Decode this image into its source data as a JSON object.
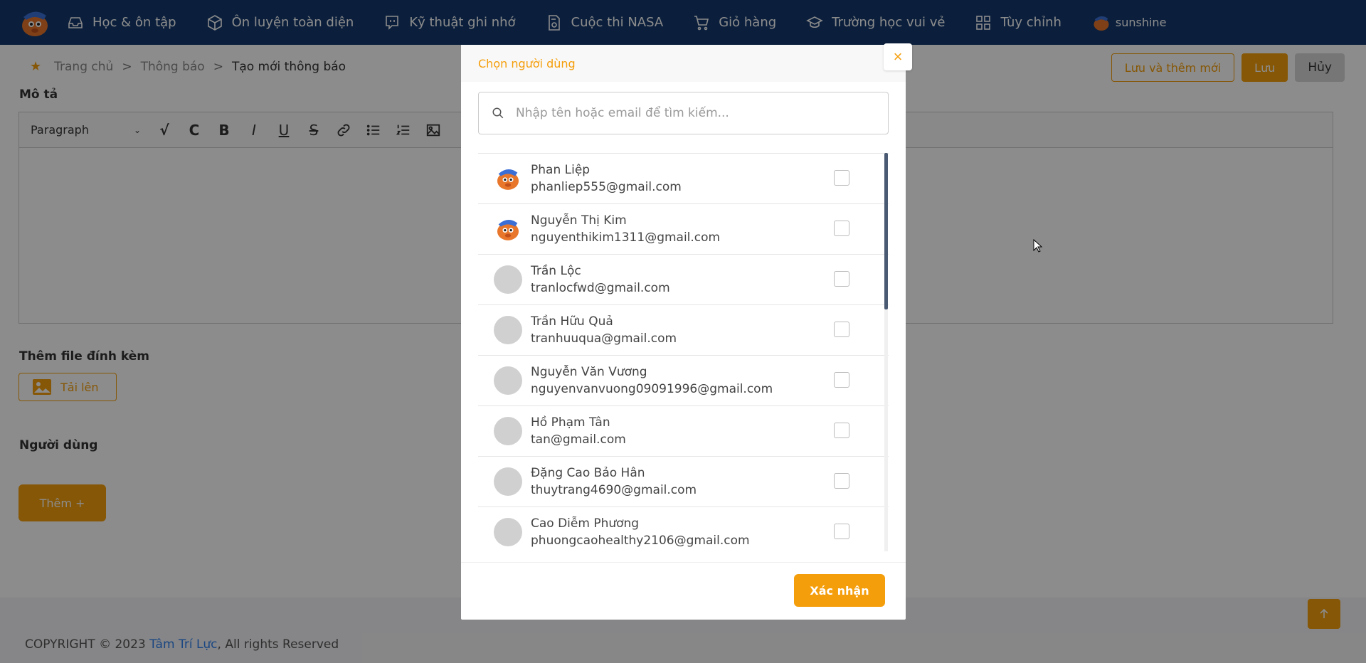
{
  "navbar": {
    "items": [
      {
        "label": "Học & ôn tập",
        "icon": "inbox-icon"
      },
      {
        "label": "Ôn luyện toàn diện",
        "icon": "cube-icon"
      },
      {
        "label": "Kỹ thuật ghi nhớ",
        "icon": "chat-icon"
      },
      {
        "label": "Cuộc thi NASA",
        "icon": "document-icon"
      },
      {
        "label": "Giỏ hàng",
        "icon": "cart-icon"
      },
      {
        "label": "Trường học vui vẻ",
        "icon": "graduation-cap-icon"
      },
      {
        "label": "Tùy chỉnh",
        "icon": "grid-icon"
      }
    ],
    "username": "sunshine"
  },
  "breadcrumb": {
    "home": "Trang chủ",
    "separator": ">",
    "section": "Thông báo",
    "current": "Tạo mới thông báo"
  },
  "actions": {
    "save_and_new": "Lưu và thêm mới",
    "save": "Lưu",
    "cancel": "Hủy"
  },
  "form": {
    "description_label": "Mô tả",
    "paragraph_select": "Paragraph",
    "attachment_label": "Thêm file đính kèm",
    "upload_label": "Tải lên",
    "users_label": "Người dùng",
    "add_label": "Thêm +"
  },
  "footer": {
    "prefix": "COPYRIGHT © 2023 ",
    "brand": "Tâm Trí Lực",
    "suffix": ", All rights Reserved"
  },
  "modal": {
    "title": "Chọn người dùng",
    "close": "×",
    "search_placeholder": "Nhập tên hoặc email để tìm kiếm...",
    "confirm": "Xác nhận",
    "users": [
      {
        "name": "Phan Liệp",
        "email": "phanliep555@gmail.com",
        "avatar": "mascot"
      },
      {
        "name": "Nguyễn Thị Kim",
        "email": "nguyenthikim1311@gmail.com",
        "avatar": "mascot"
      },
      {
        "name": "Trần Lộc",
        "email": "tranlocfwd@gmail.com",
        "avatar": "default"
      },
      {
        "name": "Trần Hữu Quả",
        "email": "tranhuuqua@gmail.com",
        "avatar": "default"
      },
      {
        "name": "Nguyễn Văn Vương",
        "email": "nguyenvanvuong09091996@gmail.com",
        "avatar": "default"
      },
      {
        "name": "Hồ Phạm Tân",
        "email": "tan@gmail.com",
        "avatar": "default"
      },
      {
        "name": "Đặng Cao Bảo Hân",
        "email": "thuytrang4690@gmail.com",
        "avatar": "default"
      },
      {
        "name": "Cao Diễm Phương",
        "email": "phuongcaohealthy2106@gmail.com",
        "avatar": "default"
      }
    ]
  },
  "colors": {
    "navbar": "#143a6e",
    "accent": "#f59e0b",
    "link": "#2f80ed"
  }
}
